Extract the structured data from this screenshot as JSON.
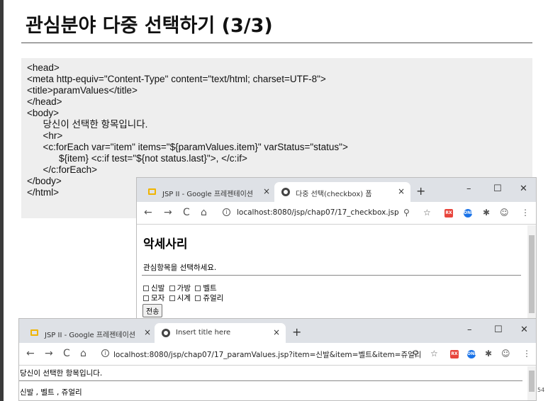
{
  "slide": {
    "title": "관심분야 다중 선택하기 (3/3)",
    "page_number": "54"
  },
  "code": [
    "<head>",
    "<meta http-equiv=\"Content-Type\" content=\"text/html; charset=UTF-8\">",
    "<title>paramValues</title>",
    "</head>",
    "<body>",
    "      당신이 선택한 항목입니다.",
    "      <hr>",
    "      <c:forEach var=\"item\" items=\"${paramValues.item}\" varStatus=\"status\">",
    "            ${item} <c:if test=\"${not status.last}\">, </c:if>",
    "      </c:forEach>",
    "</body>",
    "</html>"
  ],
  "browser1": {
    "tabs": [
      {
        "label": "JSP II - Google 프레젠테이션",
        "close": "×"
      },
      {
        "label": "다중 선택(checkbox) 폼",
        "close": "×"
      }
    ],
    "new_tab": "+",
    "window_controls": {
      "minimize": "–",
      "maximize": "☐",
      "close": "✕"
    },
    "nav": {
      "back": "←",
      "forward": "→",
      "reload": "C",
      "home": "⌂"
    },
    "url": "localhost:8080/jsp/chap07/17_checkbox.jsp",
    "page": {
      "heading": "악세사리",
      "instruction": "관심항목을 선택하세요.",
      "row1": [
        "신발",
        "가방",
        "벨트"
      ],
      "row2": [
        "모자",
        "시계",
        "쥬얼리"
      ],
      "submit_label": "전송"
    }
  },
  "browser2": {
    "tabs": [
      {
        "label": "JSP II - Google 프레젠테이션",
        "close": "×"
      },
      {
        "label": "Insert title here",
        "close": "×"
      }
    ],
    "new_tab": "+",
    "window_controls": {
      "minimize": "–",
      "maximize": "☐",
      "close": "✕"
    },
    "nav": {
      "back": "←",
      "forward": "→",
      "reload": "C",
      "home": "⌂"
    },
    "url": "localhost:8080/jsp/chap07/17_paramValues.jsp?item=신발&item=벨트&item=쥬얼리",
    "page": {
      "line1": "당신이 선택한 항목입니다.",
      "line2": "신발 , 벨트 , 쥬얼리"
    }
  },
  "colors": {
    "code_bg": "#eeeeee",
    "tabbar_bg": "#dee1e6",
    "ext_red": "#e8453c",
    "ext_blue": "#1a73e8"
  }
}
